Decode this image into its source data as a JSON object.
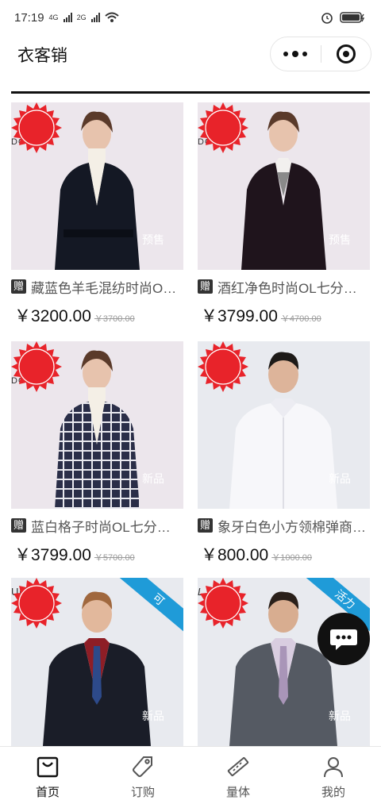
{
  "status": {
    "time": "17:19",
    "net1": "4G",
    "net2": "2G"
  },
  "nav": {
    "title": "衣客销"
  },
  "gift_label": "赠",
  "products": [
    {
      "name": "藏蓝色羊毛混纺时尚O…",
      "price": "￥3200.00",
      "old_price": "￥3700.00",
      "badge": "预售",
      "brand": "DOOR",
      "gift": true
    },
    {
      "name": "酒红净色时尚OL七分…",
      "price": "￥3799.00",
      "old_price": "￥4700.00",
      "badge": "预售",
      "brand": "DOOR",
      "gift": true
    },
    {
      "name": "蓝白格子时尚OL七分…",
      "price": "￥3799.00",
      "old_price": "￥5700.00",
      "badge": "新品",
      "brand": "DOOR",
      "gift": true
    },
    {
      "name": "象牙白色小方领棉弹商…",
      "price": "￥800.00",
      "old_price": "￥1000.00",
      "badge": "新品",
      "brand": "",
      "gift": true
    },
    {
      "name": "",
      "price": "",
      "old_price": "",
      "badge": "新品",
      "brand": "UCA",
      "ribbon": "可",
      "gift": false
    },
    {
      "name": "",
      "price": "",
      "old_price": "",
      "badge": "新品",
      "brand": "L MAR'",
      "ribbon": "活力",
      "gift": false
    }
  ],
  "tabbar": [
    {
      "label": "首页",
      "icon": "shopping-bag-icon",
      "active": true
    },
    {
      "label": "订购",
      "icon": "price-tag-icon",
      "active": false
    },
    {
      "label": "量体",
      "icon": "ruler-icon",
      "active": false
    },
    {
      "label": "我的",
      "icon": "person-icon",
      "active": false
    }
  ],
  "colors": {
    "badge_red": "#e8232a",
    "ribbon_blue": "#1f9bd8",
    "text_dark": "#111111"
  }
}
